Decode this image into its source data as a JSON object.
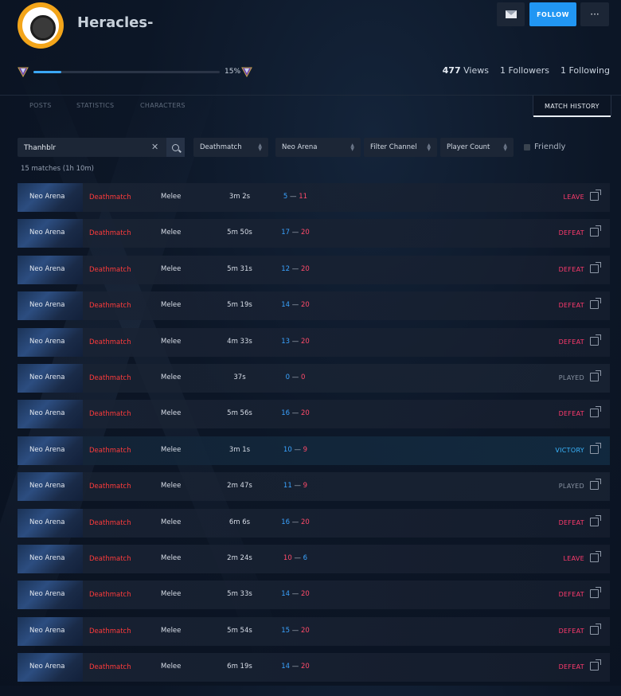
{
  "profile": {
    "username": "Heracles-",
    "progress_pct_label": "15%",
    "progress_fraction": 0.15,
    "views_count": "477",
    "views_label": "Views",
    "followers": "1 Followers",
    "following": "1 Following"
  },
  "header_buttons": {
    "follow_label": "FOLLOW",
    "more_label": "···"
  },
  "tabs": [
    {
      "label": "POSTS"
    },
    {
      "label": "STATISTICS"
    },
    {
      "label": "CHARACTERS"
    },
    {
      "label": "MATCH HISTORY"
    }
  ],
  "filters": {
    "search_value": "Thanhblr",
    "clear_label": "✕",
    "mode": "Deathmatch",
    "map": "Neo Arena",
    "channel": "Filter Channel",
    "player_count": "Player Count",
    "friendly_label": "Friendly"
  },
  "match_count_label": "15 matches (1h 10m)",
  "matches": [
    {
      "map": "Neo Arena",
      "mode": "Deathmatch",
      "weapon": "Melee",
      "duration": "3m 2s",
      "score_a": "5",
      "score_b": "11",
      "result": "LEAVE"
    },
    {
      "map": "Neo Arena",
      "mode": "Deathmatch",
      "weapon": "Melee",
      "duration": "5m 50s",
      "score_a": "17",
      "score_b": "20",
      "result": "DEFEAT"
    },
    {
      "map": "Neo Arena",
      "mode": "Deathmatch",
      "weapon": "Melee",
      "duration": "5m 31s",
      "score_a": "12",
      "score_b": "20",
      "result": "DEFEAT"
    },
    {
      "map": "Neo Arena",
      "mode": "Deathmatch",
      "weapon": "Melee",
      "duration": "5m 19s",
      "score_a": "14",
      "score_b": "20",
      "result": "DEFEAT"
    },
    {
      "map": "Neo Arena",
      "mode": "Deathmatch",
      "weapon": "Melee",
      "duration": "4m 33s",
      "score_a": "13",
      "score_b": "20",
      "result": "DEFEAT"
    },
    {
      "map": "Neo Arena",
      "mode": "Deathmatch",
      "weapon": "Melee",
      "duration": "37s",
      "score_a": "0",
      "score_b": "0",
      "result": "PLAYED"
    },
    {
      "map": "Neo Arena",
      "mode": "Deathmatch",
      "weapon": "Melee",
      "duration": "5m 56s",
      "score_a": "16",
      "score_b": "20",
      "result": "DEFEAT"
    },
    {
      "map": "Neo Arena",
      "mode": "Deathmatch",
      "weapon": "Melee",
      "duration": "3m 1s",
      "score_a": "10",
      "score_b": "9",
      "result": "VICTORY"
    },
    {
      "map": "Neo Arena",
      "mode": "Deathmatch",
      "weapon": "Melee",
      "duration": "2m 47s",
      "score_a": "11",
      "score_b": "9",
      "result": "PLAYED"
    },
    {
      "map": "Neo Arena",
      "mode": "Deathmatch",
      "weapon": "Melee",
      "duration": "6m 6s",
      "score_a": "16",
      "score_b": "20",
      "result": "DEFEAT"
    },
    {
      "map": "Neo Arena",
      "mode": "Deathmatch",
      "weapon": "Melee",
      "duration": "2m 24s",
      "score_a": "10",
      "score_b": "6",
      "result": "LEAVE"
    },
    {
      "map": "Neo Arena",
      "mode": "Deathmatch",
      "weapon": "Melee",
      "duration": "5m 33s",
      "score_a": "14",
      "score_b": "20",
      "result": "DEFEAT"
    },
    {
      "map": "Neo Arena",
      "mode": "Deathmatch",
      "weapon": "Melee",
      "duration": "5m 54s",
      "score_a": "15",
      "score_b": "20",
      "result": "DEFEAT"
    },
    {
      "map": "Neo Arena",
      "mode": "Deathmatch",
      "weapon": "Melee",
      "duration": "6m 19s",
      "score_a": "14",
      "score_b": "20",
      "result": "DEFEAT"
    }
  ],
  "colors": {
    "accent": "#2196f3",
    "defeat": "#ff3a6d",
    "victory": "#3ab6ff",
    "played": "#8892a1",
    "mode": "#ff3b3b",
    "score_blue": "#3aa3ff",
    "score_red": "#ff4b6a"
  },
  "icons": {
    "rank_left": "rank-badge-icon",
    "rank_right": "rank-badge-icon",
    "mail": "envelope-icon",
    "search": "search-icon",
    "clear": "close-icon",
    "external": "external-link-icon"
  }
}
